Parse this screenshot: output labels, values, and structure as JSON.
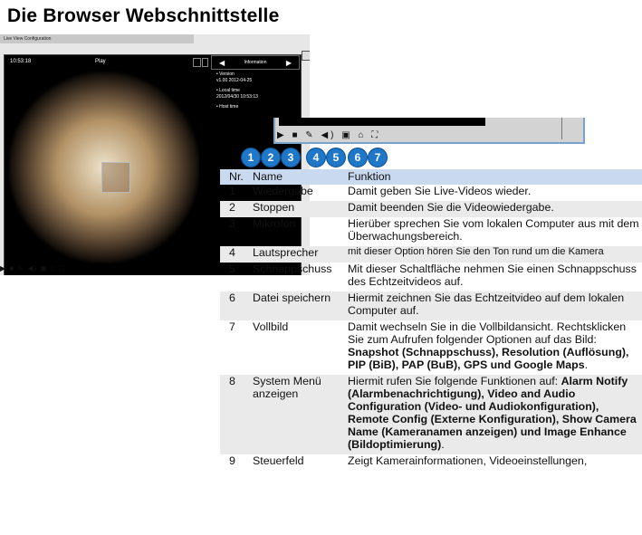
{
  "page_title": "Die Browser Webschnittstelle",
  "screenshot": {
    "window_title": "Live View Configuration",
    "time": "10:53:18",
    "state": "Play",
    "info_header": "Information",
    "info_rows": [
      {
        "label": "Version",
        "value": "v1.00  2012-04-25"
      },
      {
        "label": "Local time",
        "value": "2012/04/30 10:53:13"
      },
      {
        "label": "Host time",
        "value": ""
      }
    ],
    "controls": "▶ ■ ✎ ◀) ▣ ⌂ ⛶"
  },
  "toolbar_zoom": {
    "buttons": "▶ ■ ✎ ◀) ▣ ⌂ ⛶"
  },
  "callouts": [
    "1",
    "2",
    "3",
    "4",
    "5",
    "6",
    "7"
  ],
  "table": {
    "headers": [
      "Nr.",
      "Name",
      "Funktion"
    ],
    "rows": [
      {
        "nr": "1",
        "name": "Wiedergabe",
        "func": "Damit geben Sie Live-Videos wieder."
      },
      {
        "nr": "2",
        "name": "Stoppen",
        "func": "Damit beenden Sie die Videowiedergabe."
      },
      {
        "nr": "3",
        "name": "Mikrofon",
        "func": "Hierüber sprechen Sie vom lokalen Computer aus mit dem Überwachungsbereich."
      },
      {
        "nr": "4",
        "name": "Lautsprecher",
        "func": "mit dieser Option hören Sie den Ton rund um die Kamera"
      },
      {
        "nr": "5",
        "name": "Schnappschuss",
        "func": "Mit dieser Schaltfläche nehmen Sie einen Schnappschuss des Echtzeitvideos auf."
      },
      {
        "nr": "6",
        "name": "Datei speichern",
        "func": "Hiermit zeichnen Sie das Echtzeitvideo auf dem lokalen Computer auf."
      },
      {
        "nr": "7",
        "name": "Vollbild",
        "func_pre": "Damit wechseln Sie in die Vollbildansicht. Rechtsklicken Sie zum Aufrufen folgender Optionen auf das Bild: ",
        "func_bold": "Snapshot (Schnappschuss), Resolution (Auflösung), PIP (BiB), PAP (BuB), GPS und Google Maps",
        "func_post": "."
      },
      {
        "nr": "8",
        "name": "System Menü anzeigen",
        "func_pre": "Hiermit rufen Sie folgende Funktionen auf: ",
        "func_bold": "Alarm Notify (Alarmbenachrichtigung), Video and Audio Configuration (Video- und Audiokonfiguration), Remote Config (Externe Konfiguration), Show Camera Name (Kameranamen anzeigen) und Image Enhance (Bildoptimierung)",
        "func_post": "."
      },
      {
        "nr": "9",
        "name": "Steuerfeld",
        "func": "Zeigt Kamerainformationen, Videoeinstellungen,"
      }
    ]
  }
}
